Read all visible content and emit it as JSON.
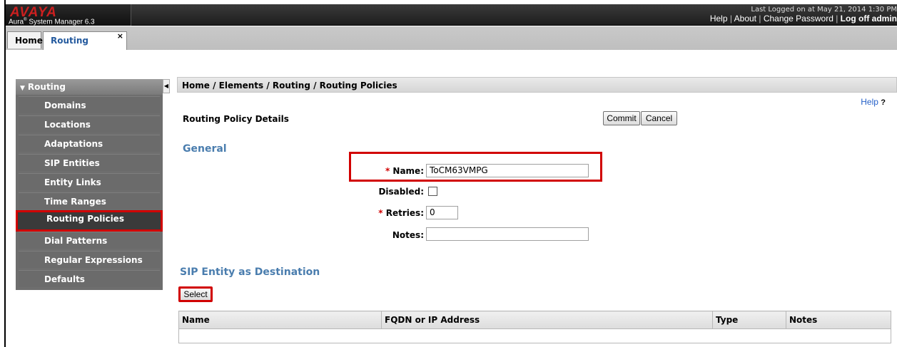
{
  "header": {
    "logo": "AVAYA",
    "product": "Aura",
    "product_version": "System Manager 6.3",
    "last_logged": "Last Logged on at May 21, 2014 1:30 PM",
    "links": {
      "help": "Help",
      "about": "About",
      "change_password": "Change Password",
      "logoff": "Log off admin"
    }
  },
  "tabs": [
    {
      "label": "Home"
    },
    {
      "label": "Routing",
      "close": "×"
    }
  ],
  "sidebar": {
    "header": "Routing",
    "items": [
      {
        "label": "Domains"
      },
      {
        "label": "Locations"
      },
      {
        "label": "Adaptations"
      },
      {
        "label": "SIP Entities"
      },
      {
        "label": "Entity Links"
      },
      {
        "label": "Time Ranges"
      },
      {
        "label": "Routing Policies"
      },
      {
        "label": "Dial Patterns"
      },
      {
        "label": "Regular Expressions"
      },
      {
        "label": "Defaults"
      }
    ],
    "selected": "Routing Policies"
  },
  "breadcrumb": "Home / Elements / Routing / Routing Policies",
  "help": {
    "label": "Help",
    "icon": "?"
  },
  "page": {
    "title": "Routing Policy Details",
    "commit": "Commit",
    "cancel": "Cancel"
  },
  "general": {
    "title": "General",
    "name_label": "Name:",
    "name_value": "ToCM63VMPG",
    "disabled_label": "Disabled:",
    "disabled_checked": false,
    "retries_label": "Retries:",
    "retries_value": "0",
    "notes_label": "Notes:",
    "notes_value": "",
    "required_mark": "*"
  },
  "sip_destination": {
    "title": "SIP Entity as Destination",
    "select": "Select",
    "columns": [
      "Name",
      "FQDN or IP Address",
      "Type",
      "Notes"
    ]
  },
  "colors": {
    "accent": "#4a7dae",
    "highlight": "#d10000",
    "brand": "#cc1f1f"
  }
}
